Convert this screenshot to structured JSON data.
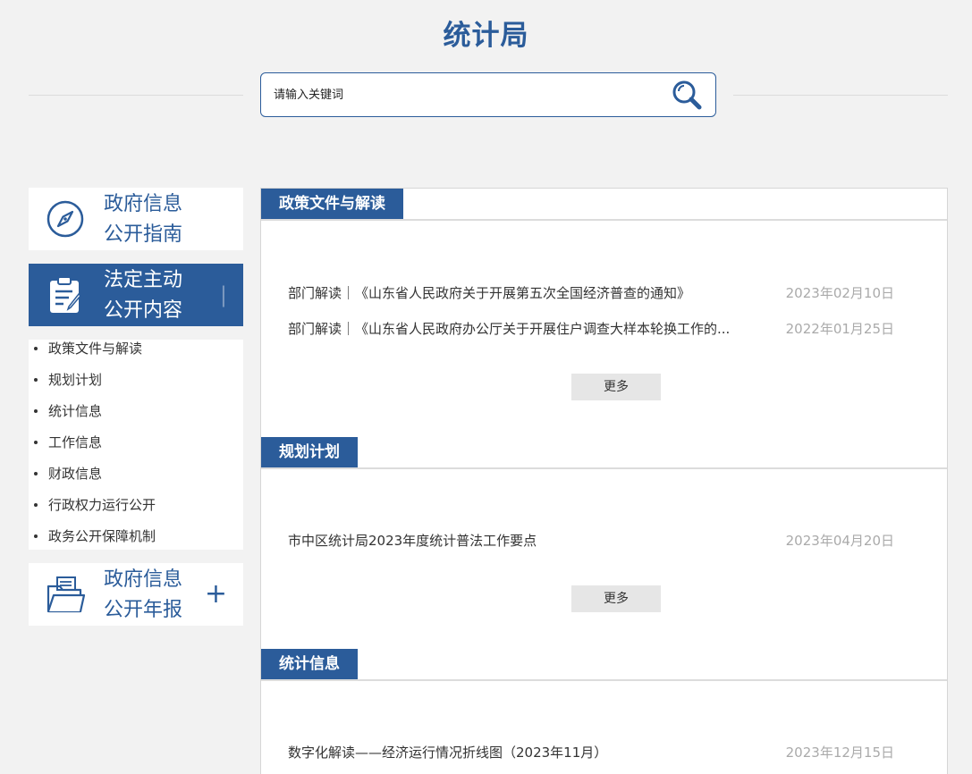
{
  "header": {
    "title": "统计局"
  },
  "search": {
    "placeholder": "请输入关键词"
  },
  "sidebar": {
    "cards": [
      {
        "line1": "政府信息",
        "line2": "公开指南",
        "icon": "compass-icon"
      },
      {
        "line1": "法定主动",
        "line2": "公开内容",
        "icon": "clipboard-icon",
        "mark": "|"
      },
      {
        "line1": "政府信息",
        "line2": "公开年报",
        "icon": "folder-icon",
        "mark": "+"
      }
    ],
    "sub_items": [
      "政策文件与解读",
      "规划计划",
      "统计信息",
      "工作信息",
      "财政信息",
      "行政权力运行公开",
      "政务公开保障机制"
    ]
  },
  "sections": [
    {
      "title": "政策文件与解读",
      "items": [
        {
          "title": "部门解读｜《山东省人民政府关于开展第五次全国经济普查的通知》",
          "date": "2023年02月10日"
        },
        {
          "title": "部门解读｜《山东省人民政府办公厅关于开展住户调查大样本轮换工作的...",
          "date": "2022年01月25日"
        }
      ],
      "more": "更多"
    },
    {
      "title": "规划计划",
      "items": [
        {
          "title": "市中区统计局2023年度统计普法工作要点",
          "date": "2023年04月20日"
        }
      ],
      "more": "更多"
    },
    {
      "title": "统计信息",
      "items": [
        {
          "title": "数字化解读——经济运行情况折线图（2023年11月）",
          "date": "2023年12月15日"
        }
      ]
    }
  ],
  "colors": {
    "brand": "#2b5c9a",
    "date": "#aaaaaa"
  }
}
